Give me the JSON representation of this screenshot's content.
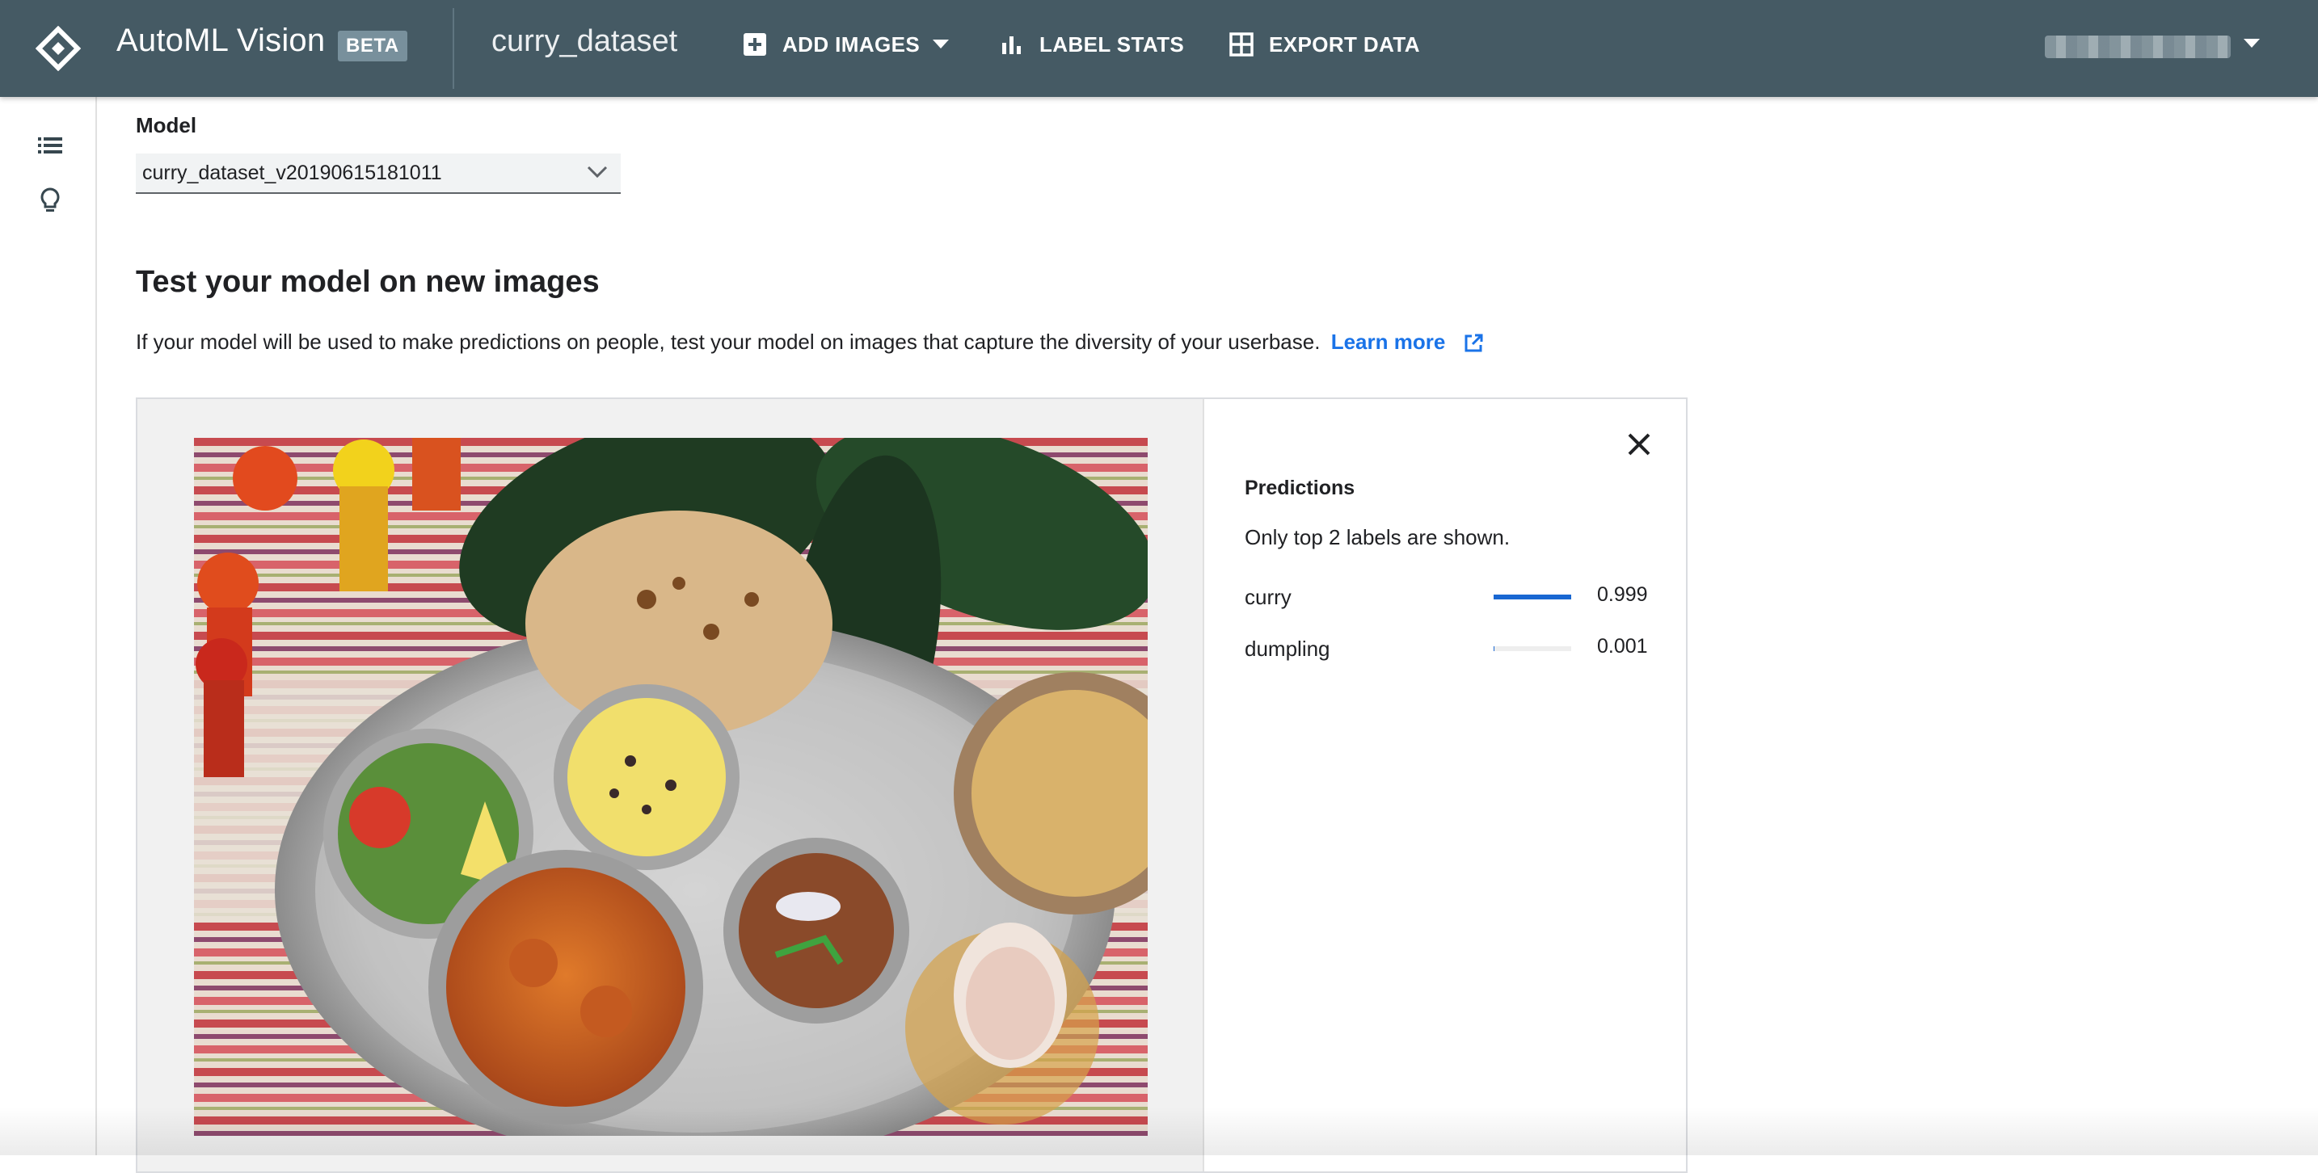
{
  "header": {
    "app_name": "AutoML Vision",
    "badge": "BETA",
    "dataset": "curry_dataset",
    "nav": {
      "add_images": "ADD IMAGES",
      "label_stats": "LABEL STATS",
      "export_data": "EXPORT DATA"
    },
    "icons": [
      "automl-logo-icon",
      "add-box-icon",
      "bar-chart-icon",
      "grid-icon",
      "dropdown-caret-icon"
    ]
  },
  "rail": {
    "icons": [
      "list-icon",
      "lightbulb-icon"
    ]
  },
  "model": {
    "label": "Model",
    "selected": "curry_dataset_v20190615181011"
  },
  "test": {
    "title": "Test your model on new images",
    "description": "If your model will be used to make predictions on people, test your model on images that capture the diversity of your userbase.",
    "learn_more": "Learn more"
  },
  "predictions": {
    "title": "Predictions",
    "note": "Only top 2 labels are shown.",
    "items": [
      {
        "label": "curry",
        "score": "0.999",
        "fraction": 0.999
      },
      {
        "label": "dumpling",
        "score": "0.001",
        "fraction": 0.001
      }
    ]
  },
  "colors": {
    "header_bg": "#455a64",
    "accent": "#1a73e8",
    "bar": "#1967d2"
  }
}
